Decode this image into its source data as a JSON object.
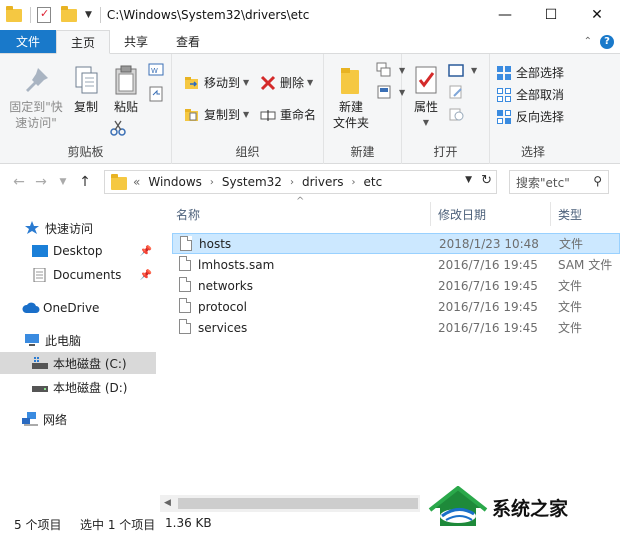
{
  "window": {
    "title_path": "C:\\Windows\\System32\\drivers\\etc",
    "minimize": "—",
    "maximize": "☐",
    "close": "✕"
  },
  "tabs": [
    {
      "label": "文件"
    },
    {
      "label": "主页"
    },
    {
      "label": "共享"
    },
    {
      "label": "查看"
    }
  ],
  "ribbon": {
    "clipboard": {
      "label": "剪贴板",
      "pin_quick_access": "固定到\"快\n速访问\"",
      "copy": "复制",
      "paste": "粘贴"
    },
    "organize": {
      "label": "组织",
      "move_to": "移动到",
      "copy_to": "复制到",
      "delete": "删除",
      "rename": "重命名"
    },
    "new": {
      "label": "新建",
      "new_folder": "新建\n文件夹"
    },
    "open": {
      "label": "打开",
      "properties": "属性"
    },
    "select": {
      "label": "选择",
      "select_all": "全部选择",
      "select_none": "全部取消",
      "invert": "反向选择"
    }
  },
  "address": {
    "breadcrumb": [
      "Windows",
      "System32",
      "drivers",
      "etc"
    ],
    "overflow": "«",
    "search_placeholder": "搜索\"etc\""
  },
  "nav": {
    "quick_access": "快速访问",
    "desktop": "Desktop",
    "documents": "Documents",
    "onedrive": "OneDrive",
    "this_pc": "此电脑",
    "drive_c": "本地磁盘 (C:)",
    "drive_d": "本地磁盘 (D:)",
    "network": "网络"
  },
  "columns": {
    "name": "名称",
    "date": "修改日期",
    "type": "类型"
  },
  "files": [
    {
      "name": "hosts",
      "date": "2018/1/23 10:48",
      "type": "文件"
    },
    {
      "name": "lmhosts.sam",
      "date": "2016/7/16 19:45",
      "type": "SAM 文件"
    },
    {
      "name": "networks",
      "date": "2016/7/16 19:45",
      "type": "文件"
    },
    {
      "name": "protocol",
      "date": "2016/7/16 19:45",
      "type": "文件"
    },
    {
      "name": "services",
      "date": "2016/7/16 19:45",
      "type": "文件"
    }
  ],
  "status": {
    "count": "5 个项目",
    "selected": "选中 1 个项目",
    "size": "1.36 KB"
  },
  "watermark": {
    "text": "系统之家"
  },
  "colors": {
    "accent": "#1979ca",
    "selection": "#cce8ff"
  }
}
